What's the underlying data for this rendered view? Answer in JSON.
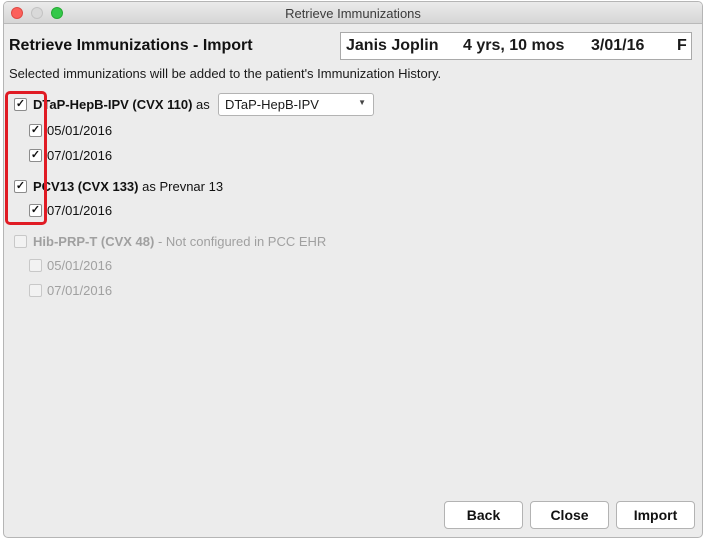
{
  "window": {
    "title": "Retrieve Immunizations"
  },
  "header": {
    "title": "Retrieve Immunizations - Import",
    "patient_name": "Janis Joplin",
    "patient_age": "4 yrs, 10 mos",
    "patient_dob": "3/01/16",
    "patient_sex": "F",
    "note": "Selected immunizations will be added to the patient's Immunization History."
  },
  "immunizations": [
    {
      "name": "DTaP-HepB-IPV (CVX 110)",
      "connector": "as",
      "mapped_to_select": "DTaP-HepB-IPV",
      "checked": true,
      "doses": [
        {
          "date": "05/01/2016",
          "checked": true
        },
        {
          "date": "07/01/2016",
          "checked": true
        }
      ]
    },
    {
      "name": "PCV13 (CVX 133)",
      "mapped_to_text": "as Prevnar 13",
      "checked": true,
      "doses": [
        {
          "date": "07/01/2016",
          "checked": true
        }
      ]
    },
    {
      "name": "Hib-PRP-T (CVX 48)",
      "status": "- Not configured in PCC EHR",
      "checked": false,
      "disabled": true,
      "doses": [
        {
          "date": "05/01/2016",
          "checked": false
        },
        {
          "date": "07/01/2016",
          "checked": false
        }
      ]
    }
  ],
  "buttons": {
    "back": "Back",
    "close": "Close",
    "import": "Import"
  },
  "colors": {
    "highlight": "#e01b24"
  }
}
